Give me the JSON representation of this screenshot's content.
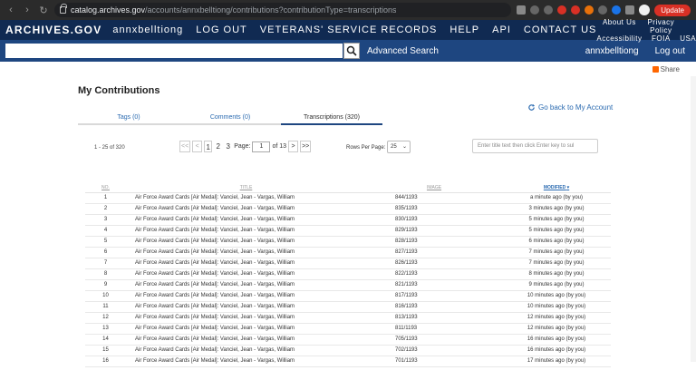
{
  "browser": {
    "url_host": "catalog.archives.gov",
    "url_path": "/accounts/annxbelltiong/contributions?contributionType=transcriptions",
    "update_label": "Update"
  },
  "header": {
    "logo": "ARCHIVES.GOV",
    "nav": [
      "annxbelltiong",
      "LOG OUT",
      "VETERANS' SERVICE RECORDS",
      "HELP",
      "API",
      "CONTACT US"
    ],
    "util": [
      "About Us",
      "Privacy Policy",
      "",
      "Accessibility",
      "FOIA",
      "USA.gov"
    ]
  },
  "search": {
    "placeholder": "",
    "advanced_label": "Advanced Search",
    "user_label": "annxbelltiong",
    "logout_label": "Log out"
  },
  "share_label": "Share",
  "page_title": "My Contributions",
  "tabs": [
    {
      "label": "Tags (0)",
      "active": false
    },
    {
      "label": "Comments (0)",
      "active": false
    },
    {
      "label": "Transcriptions (320)",
      "active": true
    }
  ],
  "go_back_label": "Go back to My Account",
  "range_text": "1 - 25 of 320",
  "pager": {
    "first": "<<",
    "prev": "<",
    "pages": [
      "1",
      "2",
      "3"
    ],
    "page_label": "Page:",
    "page_value": "1",
    "of_text": "of 13",
    "next": ">",
    "last": ">>"
  },
  "rows_per_page_label": "Rows Per Page:",
  "rows_per_page_value": "25",
  "filter_placeholder": "Enter title text then click Enter key to sul",
  "columns": {
    "no": "NO.",
    "title": "TITLE",
    "image": "IMAGE",
    "modified": "MODIFIED"
  },
  "rows": [
    {
      "no": "1",
      "title": "Air Force Award Cards [Air Medal]: Vanciel, Jean - Vargas, William",
      "image": "844/1193",
      "modified": "a minute ago (by you)"
    },
    {
      "no": "2",
      "title": "Air Force Award Cards [Air Medal]: Vanciel, Jean - Vargas, William",
      "image": "835/1193",
      "modified": "3 minutes ago (by you)"
    },
    {
      "no": "3",
      "title": "Air Force Award Cards [Air Medal]: Vanciel, Jean - Vargas, William",
      "image": "830/1193",
      "modified": "5 minutes ago (by you)"
    },
    {
      "no": "4",
      "title": "Air Force Award Cards [Air Medal]: Vanciel, Jean - Vargas, William",
      "image": "829/1193",
      "modified": "5 minutes ago (by you)"
    },
    {
      "no": "5",
      "title": "Air Force Award Cards [Air Medal]: Vanciel, Jean - Vargas, William",
      "image": "828/1193",
      "modified": "6 minutes ago (by you)"
    },
    {
      "no": "6",
      "title": "Air Force Award Cards [Air Medal]: Vanciel, Jean - Vargas, William",
      "image": "827/1193",
      "modified": "7 minutes ago (by you)"
    },
    {
      "no": "7",
      "title": "Air Force Award Cards [Air Medal]: Vanciel, Jean - Vargas, William",
      "image": "826/1193",
      "modified": "7 minutes ago (by you)"
    },
    {
      "no": "8",
      "title": "Air Force Award Cards [Air Medal]: Vanciel, Jean - Vargas, William",
      "image": "822/1193",
      "modified": "8 minutes ago (by you)"
    },
    {
      "no": "9",
      "title": "Air Force Award Cards [Air Medal]: Vanciel, Jean - Vargas, William",
      "image": "821/1193",
      "modified": "9 minutes ago (by you)"
    },
    {
      "no": "10",
      "title": "Air Force Award Cards [Air Medal]: Vanciel, Jean - Vargas, William",
      "image": "817/1193",
      "modified": "10 minutes ago (by you)"
    },
    {
      "no": "11",
      "title": "Air Force Award Cards [Air Medal]: Vanciel, Jean - Vargas, William",
      "image": "816/1193",
      "modified": "10 minutes ago (by you)"
    },
    {
      "no": "12",
      "title": "Air Force Award Cards [Air Medal]: Vanciel, Jean - Vargas, William",
      "image": "813/1193",
      "modified": "12 minutes ago (by you)"
    },
    {
      "no": "13",
      "title": "Air Force Award Cards [Air Medal]: Vanciel, Jean - Vargas, William",
      "image": "811/1193",
      "modified": "12 minutes ago (by you)"
    },
    {
      "no": "14",
      "title": "Air Force Award Cards [Air Medal]: Vanciel, Jean - Vargas, William",
      "image": "705/1193",
      "modified": "16 minutes ago (by you)"
    },
    {
      "no": "15",
      "title": "Air Force Award Cards [Air Medal]: Vanciel, Jean - Vargas, William",
      "image": "702/1193",
      "modified": "16 minutes ago (by you)"
    },
    {
      "no": "16",
      "title": "Air Force Award Cards [Air Medal]: Vanciel, Jean - Vargas, William",
      "image": "701/1193",
      "modified": "17 minutes ago (by you)"
    }
  ]
}
